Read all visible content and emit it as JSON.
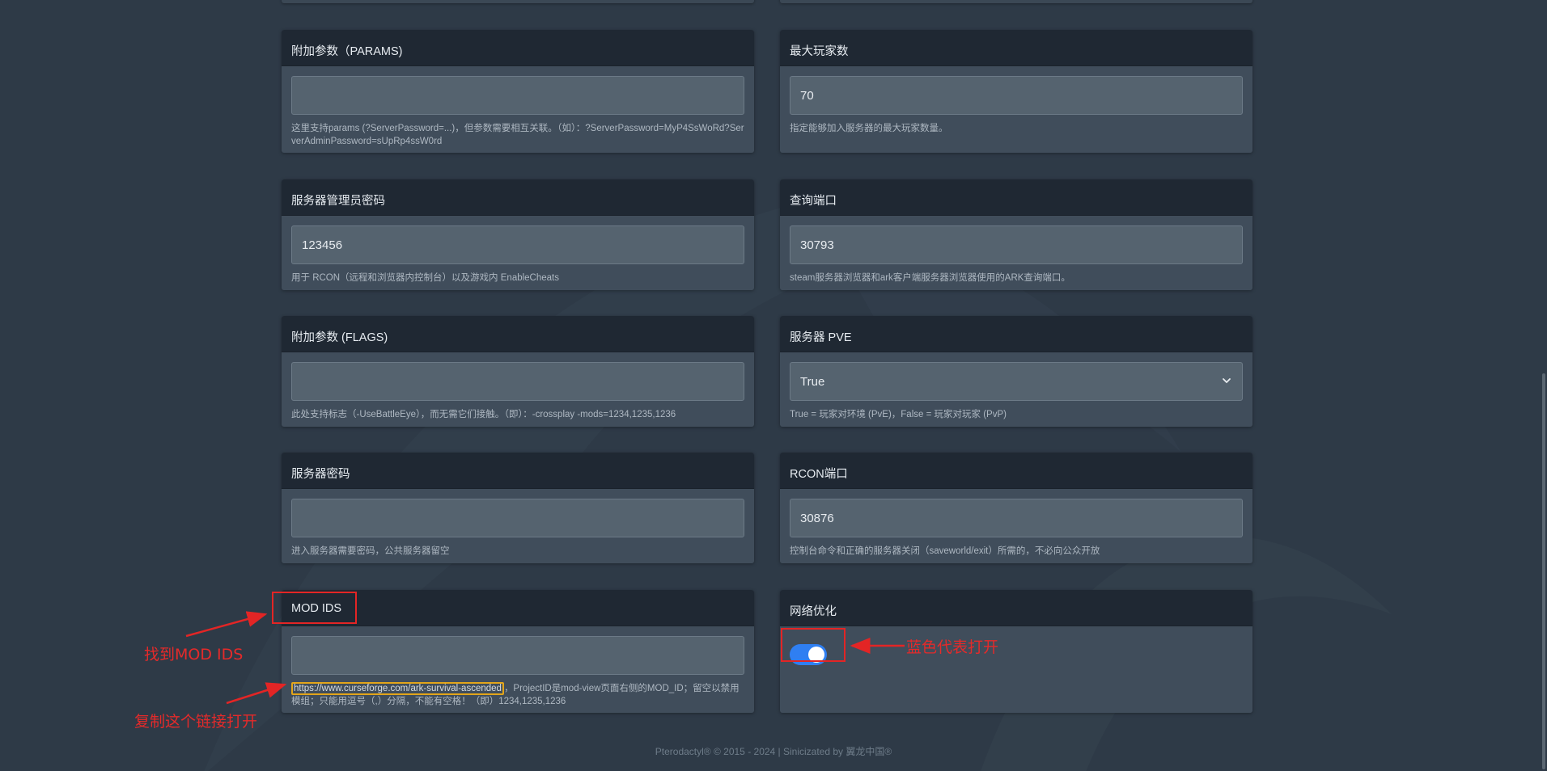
{
  "cards": {
    "params": {
      "title": "附加参数（PARAMS)",
      "value": "",
      "help": "这里支持params (?ServerPassword=...)，但参数需要相互关联。（如）：?ServerPassword=MyP4SsWoRd?ServerAdminPassword=sUpRp4ssW0rd"
    },
    "max_players": {
      "title": "最大玩家数",
      "value": "70",
      "help": "指定能够加入服务器的最大玩家数量。"
    },
    "admin_password": {
      "title": "服务器管理员密码",
      "value": "123456",
      "help": "用于 RCON（远程和浏览器内控制台）以及游戏内 EnableCheats"
    },
    "query_port": {
      "title": "查询端口",
      "value": "30793",
      "help": "steam服务器浏览器和ark客户端服务器浏览器使用的ARK查询端口。"
    },
    "flags": {
      "title": "附加参数 (FLAGS)",
      "value": "",
      "help": "此处支持标志（-UseBattleEye），而无需它们接触。（即）：-crossplay -mods=1234,1235,1236"
    },
    "pve": {
      "title": "服务器 PVE",
      "selected": "True",
      "help": "True = 玩家对环境 (PvE)，False = 玩家对玩家 (PvP)"
    },
    "server_password": {
      "title": "服务器密码",
      "value": "",
      "help": "进入服务器需要密码，公共服务器留空"
    },
    "rcon_port": {
      "title": "RCON端口",
      "value": "30876",
      "help": "控制台命令和正确的服务器关闭（saveworld/exit）所需的，不必向公众开放"
    },
    "mod_ids": {
      "title": "MOD IDS",
      "value": "",
      "help_link": "https://www.curseforge.com/ark-survival-ascended",
      "help_rest": "，ProjectID是mod-view页面右侧的MOD_ID；留空以禁用模组；只能用逗号（,）分隔，不能有空格！（即）1234,1235,1236"
    },
    "network": {
      "title": "网络优化",
      "toggle_on": true
    }
  },
  "annotations": {
    "find_mod_ids": "找到MOD IDS",
    "copy_link": "复制这个链接打开",
    "blue_means_on": "蓝色代表打开"
  },
  "footer": "Pterodactyl® © 2015 - 2024 | Sinicizated by 翼龙中国®",
  "colors": {
    "background": "#2e3a47",
    "card": "#424f5c",
    "card_header": "#1f2833",
    "toggle_on": "#2f7ff2",
    "annotation": "#e32525",
    "link_highlight": "#e2a51a"
  }
}
